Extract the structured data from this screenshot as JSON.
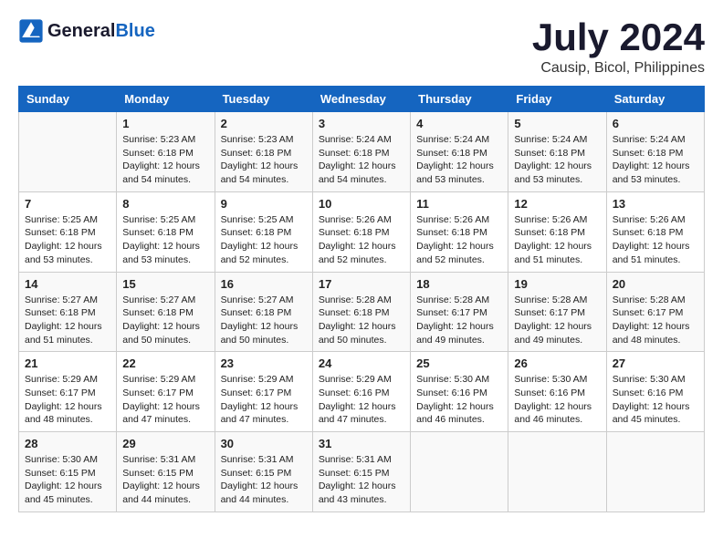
{
  "logo": {
    "line1": "General",
    "line2": "Blue"
  },
  "title": "July 2024",
  "location": "Causip, Bicol, Philippines",
  "weekdays": [
    "Sunday",
    "Monday",
    "Tuesday",
    "Wednesday",
    "Thursday",
    "Friday",
    "Saturday"
  ],
  "weeks": [
    [
      {
        "day": "",
        "info": ""
      },
      {
        "day": "1",
        "info": "Sunrise: 5:23 AM\nSunset: 6:18 PM\nDaylight: 12 hours\nand 54 minutes."
      },
      {
        "day": "2",
        "info": "Sunrise: 5:23 AM\nSunset: 6:18 PM\nDaylight: 12 hours\nand 54 minutes."
      },
      {
        "day": "3",
        "info": "Sunrise: 5:24 AM\nSunset: 6:18 PM\nDaylight: 12 hours\nand 54 minutes."
      },
      {
        "day": "4",
        "info": "Sunrise: 5:24 AM\nSunset: 6:18 PM\nDaylight: 12 hours\nand 53 minutes."
      },
      {
        "day": "5",
        "info": "Sunrise: 5:24 AM\nSunset: 6:18 PM\nDaylight: 12 hours\nand 53 minutes."
      },
      {
        "day": "6",
        "info": "Sunrise: 5:24 AM\nSunset: 6:18 PM\nDaylight: 12 hours\nand 53 minutes."
      }
    ],
    [
      {
        "day": "7",
        "info": ""
      },
      {
        "day": "8",
        "info": "Sunrise: 5:25 AM\nSunset: 6:18 PM\nDaylight: 12 hours\nand 53 minutes."
      },
      {
        "day": "9",
        "info": "Sunrise: 5:25 AM\nSunset: 6:18 PM\nDaylight: 12 hours\nand 52 minutes."
      },
      {
        "day": "10",
        "info": "Sunrise: 5:26 AM\nSunset: 6:18 PM\nDaylight: 12 hours\nand 52 minutes."
      },
      {
        "day": "11",
        "info": "Sunrise: 5:26 AM\nSunset: 6:18 PM\nDaylight: 12 hours\nand 52 minutes."
      },
      {
        "day": "12",
        "info": "Sunrise: 5:26 AM\nSunset: 6:18 PM\nDaylight: 12 hours\nand 51 minutes."
      },
      {
        "day": "13",
        "info": "Sunrise: 5:26 AM\nSunset: 6:18 PM\nDaylight: 12 hours\nand 51 minutes."
      }
    ],
    [
      {
        "day": "14",
        "info": ""
      },
      {
        "day": "15",
        "info": "Sunrise: 5:27 AM\nSunset: 6:18 PM\nDaylight: 12 hours\nand 50 minutes."
      },
      {
        "day": "16",
        "info": "Sunrise: 5:27 AM\nSunset: 6:18 PM\nDaylight: 12 hours\nand 50 minutes."
      },
      {
        "day": "17",
        "info": "Sunrise: 5:28 AM\nSunset: 6:18 PM\nDaylight: 12 hours\nand 50 minutes."
      },
      {
        "day": "18",
        "info": "Sunrise: 5:28 AM\nSunset: 6:17 PM\nDaylight: 12 hours\nand 49 minutes."
      },
      {
        "day": "19",
        "info": "Sunrise: 5:28 AM\nSunset: 6:17 PM\nDaylight: 12 hours\nand 49 minutes."
      },
      {
        "day": "20",
        "info": "Sunrise: 5:28 AM\nSunset: 6:17 PM\nDaylight: 12 hours\nand 48 minutes."
      }
    ],
    [
      {
        "day": "21",
        "info": ""
      },
      {
        "day": "22",
        "info": "Sunrise: 5:29 AM\nSunset: 6:17 PM\nDaylight: 12 hours\nand 47 minutes."
      },
      {
        "day": "23",
        "info": "Sunrise: 5:29 AM\nSunset: 6:17 PM\nDaylight: 12 hours\nand 47 minutes."
      },
      {
        "day": "24",
        "info": "Sunrise: 5:29 AM\nSunset: 6:16 PM\nDaylight: 12 hours\nand 47 minutes."
      },
      {
        "day": "25",
        "info": "Sunrise: 5:30 AM\nSunset: 6:16 PM\nDaylight: 12 hours\nand 46 minutes."
      },
      {
        "day": "26",
        "info": "Sunrise: 5:30 AM\nSunset: 6:16 PM\nDaylight: 12 hours\nand 46 minutes."
      },
      {
        "day": "27",
        "info": "Sunrise: 5:30 AM\nSunset: 6:16 PM\nDaylight: 12 hours\nand 45 minutes."
      }
    ],
    [
      {
        "day": "28",
        "info": "Sunrise: 5:30 AM\nSunset: 6:15 PM\nDaylight: 12 hours\nand 45 minutes."
      },
      {
        "day": "29",
        "info": "Sunrise: 5:31 AM\nSunset: 6:15 PM\nDaylight: 12 hours\nand 44 minutes."
      },
      {
        "day": "30",
        "info": "Sunrise: 5:31 AM\nSunset: 6:15 PM\nDaylight: 12 hours\nand 44 minutes."
      },
      {
        "day": "31",
        "info": "Sunrise: 5:31 AM\nSunset: 6:15 PM\nDaylight: 12 hours\nand 43 minutes."
      },
      {
        "day": "",
        "info": ""
      },
      {
        "day": "",
        "info": ""
      },
      {
        "day": "",
        "info": ""
      }
    ]
  ],
  "week2_sun_info": "Sunrise: 5:25 AM\nSunset: 6:18 PM\nDaylight: 12 hours\nand 53 minutes.",
  "week3_sun_info": "Sunrise: 5:27 AM\nSunset: 6:18 PM\nDaylight: 12 hours\nand 51 minutes.",
  "week4_sun_info": "Sunrise: 5:29 AM\nSunset: 6:17 PM\nDaylight: 12 hours\nand 48 minutes."
}
